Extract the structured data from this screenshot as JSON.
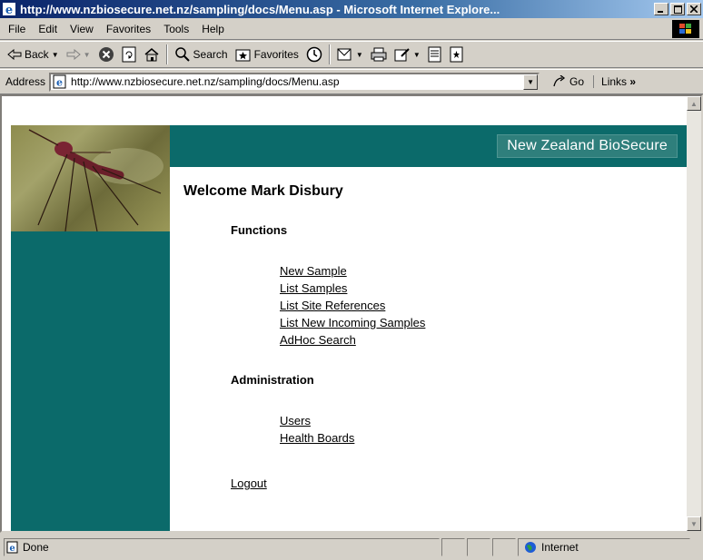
{
  "window": {
    "title": "http://www.nzbiosecure.net.nz/sampling/docs/Menu.asp - Microsoft Internet Explore...",
    "controls": [
      "_",
      "□",
      "X"
    ]
  },
  "menubar": {
    "items": [
      "File",
      "Edit",
      "View",
      "Favorites",
      "Tools",
      "Help"
    ]
  },
  "toolbar": {
    "back_label": "Back",
    "search_label": "Search",
    "favorites_label": "Favorites"
  },
  "address": {
    "label": "Address",
    "url": "http://www.nzbiosecure.net.nz/sampling/docs/Menu.asp",
    "go_label": "Go",
    "links_label": "Links"
  },
  "page": {
    "brand": "New Zealand BioSecure",
    "welcome": "Welcome Mark Disbury",
    "functions_heading": "Functions",
    "functions_links": [
      "New Sample",
      "List Samples",
      "List Site References",
      "List New Incoming Samples",
      "AdHoc Search"
    ],
    "admin_heading": "Administration",
    "admin_links": [
      "Users",
      "Health Boards"
    ],
    "logout": "Logout",
    "colors": {
      "teal": "#0b6a6a"
    }
  },
  "status": {
    "text": "Done",
    "zone": "Internet"
  }
}
